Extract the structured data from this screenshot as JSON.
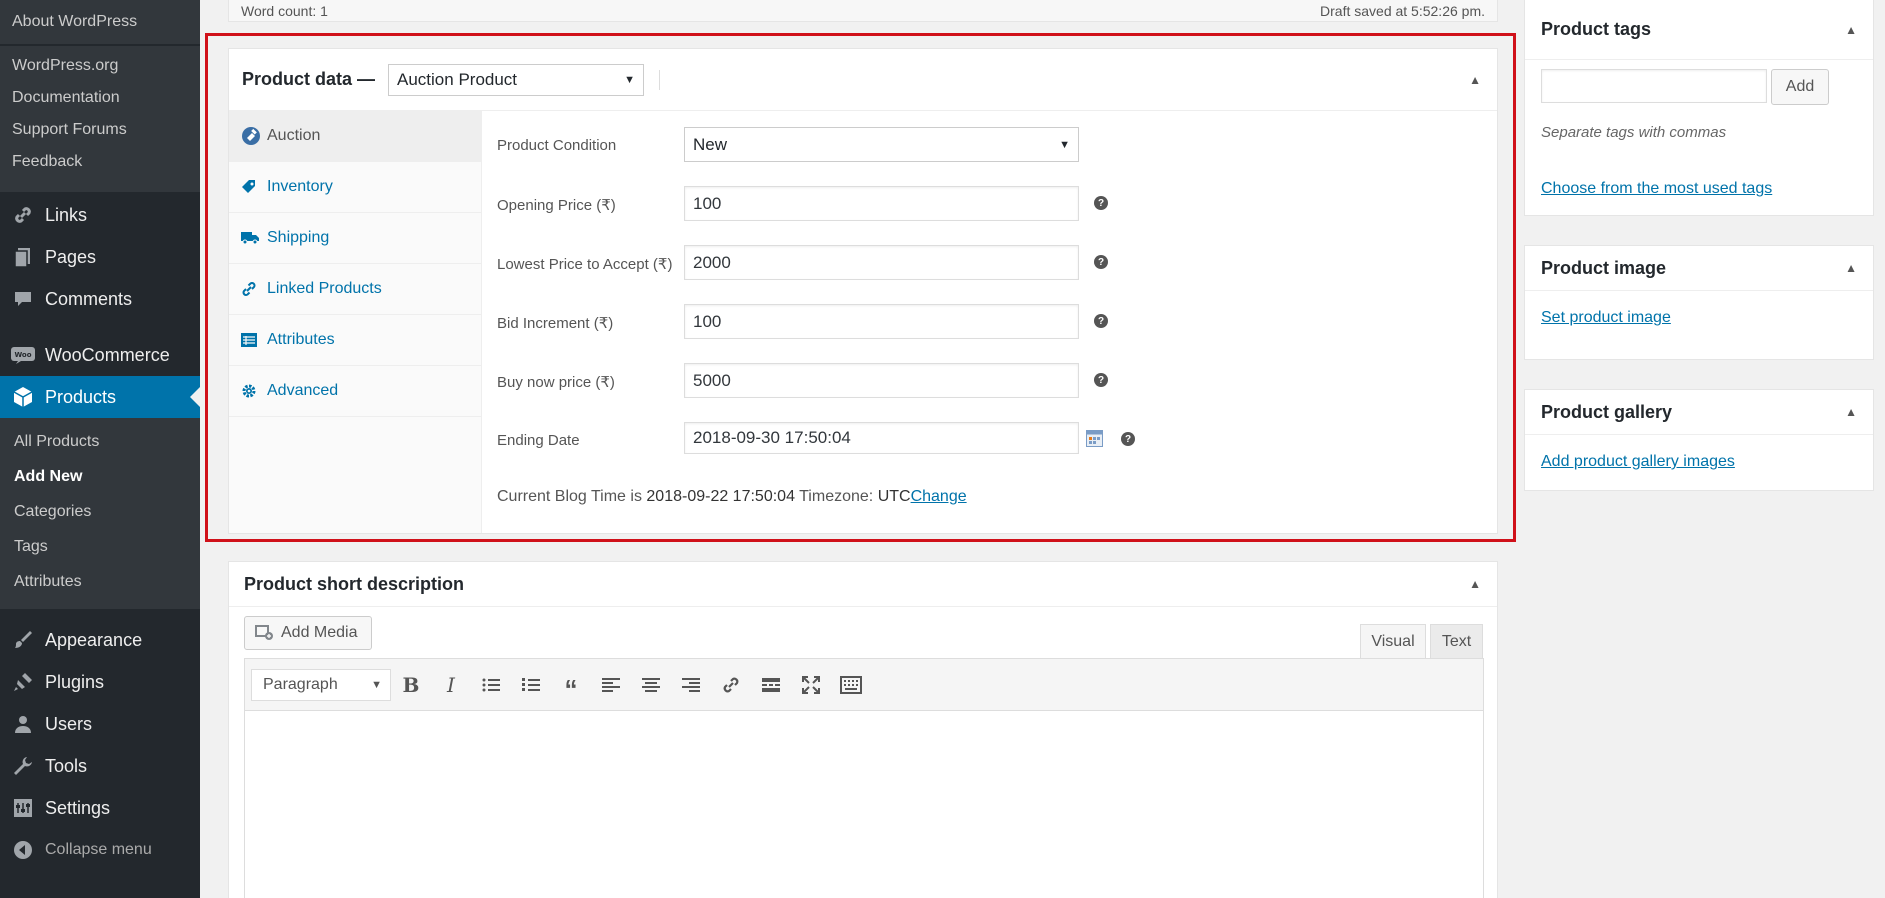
{
  "sidebar": {
    "about": "About WordPress",
    "wp_links": [
      "WordPress.org",
      "Documentation",
      "Support Forums",
      "Feedback"
    ],
    "menu": {
      "links": "Links",
      "pages": "Pages",
      "comments": "Comments",
      "woocommerce": "WooCommerce",
      "products": "Products",
      "appearance": "Appearance",
      "plugins": "Plugins",
      "users": "Users",
      "tools": "Tools",
      "settings": "Settings",
      "collapse": "Collapse menu"
    },
    "products_sub": [
      "All Products",
      "Add New",
      "Categories",
      "Tags",
      "Attributes"
    ]
  },
  "editor_status": {
    "word_count": "Word count: 1",
    "draft_saved": "Draft saved at 5:52:26 pm."
  },
  "product_data": {
    "title": "Product data —",
    "type_selected": "Auction Product",
    "tabs": [
      "Auction",
      "Inventory",
      "Shipping",
      "Linked Products",
      "Attributes",
      "Advanced"
    ],
    "fields": {
      "condition_label": "Product Condition",
      "condition_value": "New",
      "opening_label": "Opening Price (₹)",
      "opening_value": "100",
      "lowest_label": "Lowest Price to Accept (₹)",
      "lowest_value": "2000",
      "increment_label": "Bid Increment (₹)",
      "increment_value": "100",
      "buynow_label": "Buy now price (₹)",
      "buynow_value": "5000",
      "ending_label": "Ending Date",
      "ending_value": "2018-09-30 17:50:04"
    },
    "blog_time": {
      "prefix": "Current Blog Time is",
      "time": "2018-09-22 17:50:04",
      "tz_label": "Timezone:",
      "tz": "UTC",
      "change": "Change"
    }
  },
  "short_desc": {
    "title": "Product short description",
    "add_media": "Add Media",
    "tab_visual": "Visual",
    "tab_text": "Text",
    "format": "Paragraph"
  },
  "right": {
    "tags_title": "Product tags",
    "tags_add": "Add",
    "tags_hint": "Separate tags with commas",
    "tags_choose": "Choose from the most used tags",
    "image_title": "Product image",
    "image_link": "Set product image",
    "gallery_title": "Product gallery",
    "gallery_link": "Add product gallery images"
  },
  "colors": {
    "sidebar_bg": "#23282d",
    "active_menu": "#0073aa",
    "link": "#0073aa",
    "highlight_border": "#d0111a"
  }
}
